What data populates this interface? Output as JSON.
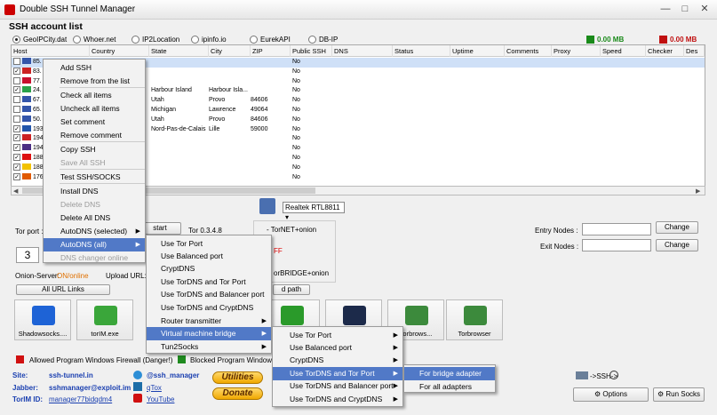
{
  "window": {
    "title": "Double SSH Tunnel Manager"
  },
  "group_title": "SSH account list",
  "sources": [
    "GeoIPCity.dat",
    "Whoer.net",
    "IP2Location",
    "ipinfo.io",
    "EurekAPI",
    "DB-IP"
  ],
  "traffic": {
    "down": "0.00 MB",
    "up": "0.00 MB",
    "down_color": "#1a8a1a",
    "up_color": "#c01010"
  },
  "columns": [
    "Host",
    "Country",
    "State",
    "City",
    "ZIP",
    "Public SSH",
    "DNS",
    "Status",
    "Uptime",
    "Comments",
    "Proxy",
    "Speed",
    "Checker",
    "Des"
  ],
  "rows": [
    {
      "host": "85.",
      "state": "",
      "city": "",
      "zip": "",
      "pub": "No",
      "checked": false
    },
    {
      "host": "83.",
      "state": "",
      "city": "",
      "zip": "",
      "pub": "No",
      "checked": true
    },
    {
      "host": "77.",
      "state": "",
      "city": "",
      "zip": "",
      "pub": "No",
      "checked": false
    },
    {
      "host": "24.",
      "state": "Harbour Island",
      "city": "Harbour Isla...",
      "zip": "",
      "pub": "No",
      "checked": true
    },
    {
      "host": "67.",
      "state": "Utah",
      "city": "Provo",
      "zip": "84606",
      "pub": "No",
      "checked": false
    },
    {
      "host": "65.",
      "state": "Michigan",
      "city": "Lawrence",
      "zip": "49064",
      "pub": "No",
      "checked": false
    },
    {
      "host": "50.",
      "state": "Utah",
      "city": "Provo",
      "zip": "84606",
      "pub": "No",
      "checked": false
    },
    {
      "host": "193",
      "state": "Nord-Pas-de-Calais",
      "city": "Lille",
      "zip": "59000",
      "pub": "No",
      "checked": true
    },
    {
      "host": "194",
      "state": "",
      "city": "",
      "zip": "",
      "pub": "No",
      "checked": true
    },
    {
      "host": "194",
      "state": "",
      "city": "",
      "zip": "",
      "pub": "No",
      "checked": true
    },
    {
      "host": "188",
      "state": "",
      "city": "",
      "zip": "",
      "pub": "No",
      "checked": true
    },
    {
      "host": "188",
      "state": "",
      "city": "",
      "zip": "",
      "pub": "No",
      "checked": true
    },
    {
      "host": "176",
      "state": "",
      "city": "",
      "zip": "",
      "pub": "No",
      "checked": true
    }
  ],
  "context_menu": [
    {
      "label": "Add SSH",
      "disabled": false
    },
    {
      "label": "Remove from the list",
      "disabled": false
    },
    {
      "label": "Check all items",
      "disabled": false
    },
    {
      "label": "Uncheck all items",
      "disabled": false
    },
    {
      "label": "Set comment",
      "disabled": false
    },
    {
      "label": "Remove comment",
      "disabled": false
    },
    {
      "label": "Copy SSH",
      "disabled": false
    },
    {
      "label": "Save All SSH",
      "disabled": true
    },
    {
      "label": "Test SSH/SOCKS",
      "disabled": false
    },
    {
      "label": "Install DNS",
      "disabled": false
    },
    {
      "label": "Delete DNS",
      "disabled": true
    },
    {
      "label": "Delete All DNS",
      "disabled": false
    },
    {
      "label": "AutoDNS (selected)",
      "disabled": false
    },
    {
      "label": "AutoDNS (all)",
      "disabled": false
    },
    {
      "label": "DNS changer online",
      "disabled": true
    }
  ],
  "submenu1": [
    "Use Tor Port",
    "Use Balanced port",
    "CryptDNS",
    "Use TorDNS and Tor Port",
    "Use TorDNS and Balancer port",
    "Use TorDNS and CryptDNS",
    "Router transmitter",
    "Virtual machine bridge",
    "Tun2Socks"
  ],
  "submenu2": [
    "Use Tor Port",
    "Use Balanced port",
    "CryptDNS",
    "Use TorDNS and Tor Port",
    "Use TorDNS and Balancer port",
    "Use TorDNS and CryptDNS"
  ],
  "submenu3": [
    "For bridge adapter",
    "For all adapters"
  ],
  "adapter": "Realtek RTL8811",
  "tor": {
    "port_label": "Tor port :",
    "port_value": "3",
    "restart": "start",
    "version": "Tor 0.3.4.8",
    "torNet": "- TorNET+onion",
    "off": "FF",
    "bridge": "orBRIDGE+onion"
  },
  "onion_server_label": "Onion-Server:",
  "onion_status": "ON/online",
  "upload_url_label": "Upload URL:",
  "all_url_links": "All URL Links",
  "add_path": "d path",
  "entry_nodes_label": "Entry Nodes :",
  "exit_nodes_label": "Exit Nodes :",
  "change": "Change",
  "tiles": [
    {
      "label": "Shadowsocks....",
      "color": "#1e63d6"
    },
    {
      "label": "torIM.exe",
      "color": "#3aa63a"
    },
    {
      "label": "",
      "color": "#2a9a2a"
    },
    {
      "label": "",
      "color": "#1c2a4a"
    },
    {
      "label": "Torbrows...",
      "color": "#3c8a3c"
    },
    {
      "label": "Torbrowser",
      "color": "#3c8a3c"
    }
  ],
  "legend_allowed": "Allowed Program Windows Firewall (Danger!)",
  "legend_blocked": "Blocked Program Windows F",
  "footer": {
    "site_label": "Site:",
    "site": "ssh-tunnel.in",
    "jabber_label": "Jabber:",
    "jabber": "sshmanager@exploit.im",
    "torim_label": "TorIM ID:",
    "torim": "manager77bidqdm4",
    "telegram": "@ssh_manager",
    "qtox": "qTox",
    "youtube": "YouTube",
    "utilities": "Utilities",
    "donate": "Donate",
    "ssh_arrow": "->SSH->",
    "options": "Options",
    "run": "Run Socks"
  }
}
